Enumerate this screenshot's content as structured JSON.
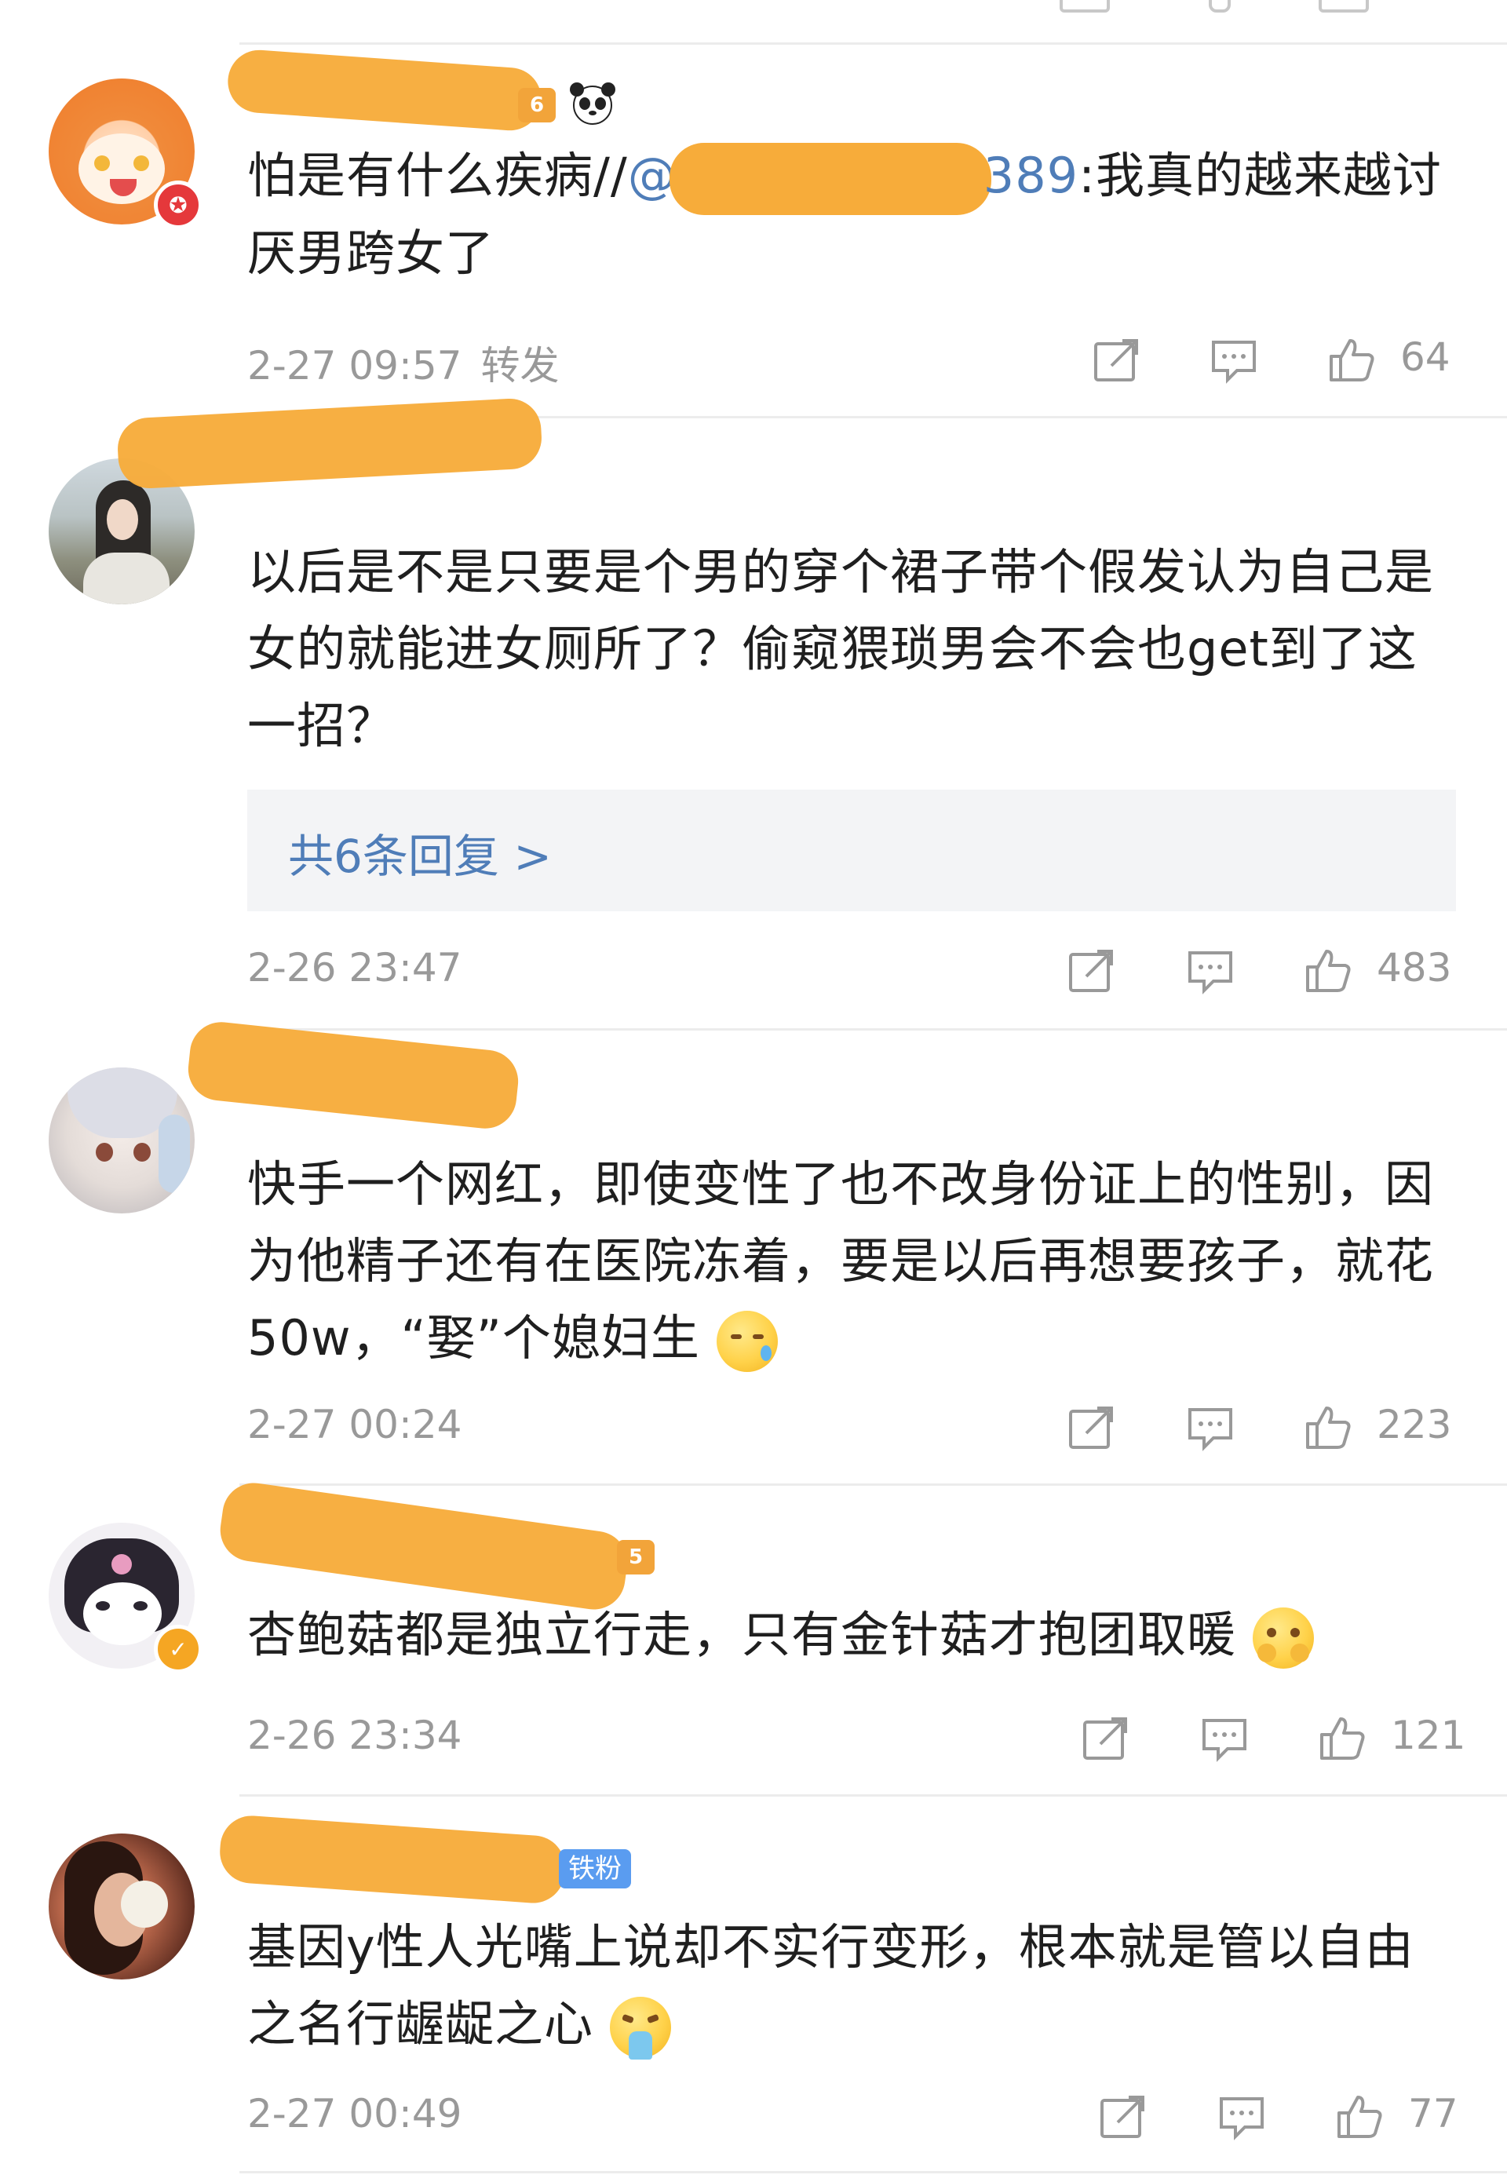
{
  "comments": [
    {
      "id": "c1",
      "body_pre": "怕是有什么疾病//",
      "mention_start": "@",
      "mention_end": "389",
      "body_post": ":我真的越来越讨厌男跨女了",
      "time": "2-27 09:57",
      "source": "转发",
      "likes": "64",
      "level": "6"
    },
    {
      "id": "c2",
      "body": "以后是不是只要是个男的穿个裙子带个假发认为自己是女的就能进女厕所了？偷窥猥琐男会不会也get到了这一招？",
      "replies_label": "共6条回复 >",
      "time": "2-26 23:47",
      "likes": "483"
    },
    {
      "id": "c3",
      "body": "快手一个网红，即使变性了也不改身份证上的性别，因为他精子还有在医院冻着，要是以后再想要孩子，就花50w，“娶”个媳妇生",
      "time": "2-27 00:24",
      "likes": "223"
    },
    {
      "id": "c4",
      "body": "杏鲍菇都是独立行走，只有金针菇才抱团取暖",
      "time": "2-26 23:34",
      "likes": "121",
      "level": "5"
    },
    {
      "id": "c5",
      "body": "基因y性人光嘴上说却不实行变形，根本就是管以自由之名行龌龊之心",
      "fan_badge": "铁粉",
      "time": "2-27 00:49",
      "likes": "77"
    }
  ],
  "icons": {
    "share": "share-icon",
    "comment": "comment-icon",
    "like": "thumbs-up-icon"
  },
  "colors": {
    "link": "#4f7db8",
    "meta": "#999999",
    "redaction": "#f7ac3a",
    "fan_badge": "#5a9cf0"
  }
}
